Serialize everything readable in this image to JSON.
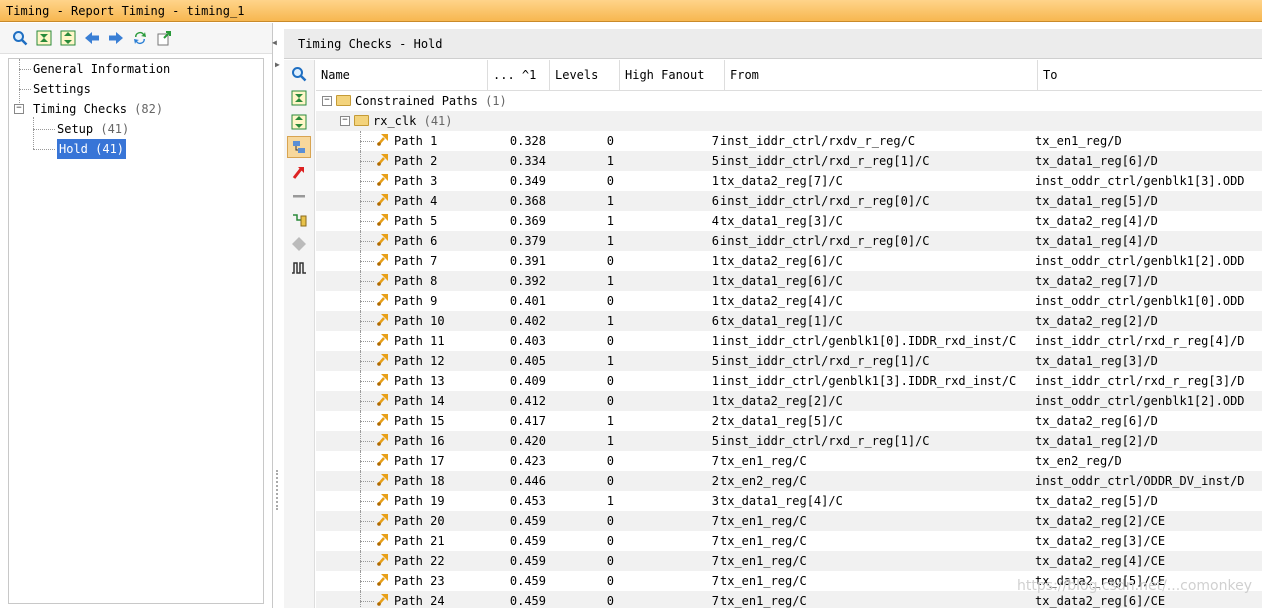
{
  "window": {
    "title": "Timing - Report Timing - timing_1"
  },
  "left_toolbar": {
    "icons": [
      "search-icon",
      "collapse-all-icon",
      "expand-all-icon",
      "back-icon",
      "forward-icon",
      "refresh-icon",
      "export-icon"
    ]
  },
  "tree": {
    "general": "General Information",
    "settings": "Settings",
    "timing_checks": {
      "label": "Timing Checks",
      "count": "(82)"
    },
    "setup": {
      "label": "Setup",
      "count": "(41)"
    },
    "hold": {
      "label": "Hold (41)"
    }
  },
  "panel": {
    "title": "Timing Checks - Hold"
  },
  "vtoolbar": {
    "icons": [
      "search-icon",
      "collapse-all-icon",
      "expand-all-icon",
      "group-icon",
      "route-icon",
      "minus-icon",
      "schematic-icon",
      "diamond-icon",
      "waveform-icon"
    ]
  },
  "table": {
    "headers": {
      "name": "Name",
      "slack": "... ^1",
      "levels": "Levels",
      "fanout": "High Fanout",
      "from": "From",
      "to": "To"
    },
    "group": {
      "label": "Constrained Paths",
      "count": "(1)"
    },
    "clock": {
      "label": "rx_clk",
      "count": "(41)"
    },
    "rows": [
      {
        "name": "Path 1",
        "slack": "0.328",
        "levels": "0",
        "fanout": "7",
        "from": "inst_iddr_ctrl/rxdv_r_reg/C",
        "to": "tx_en1_reg/D"
      },
      {
        "name": "Path 2",
        "slack": "0.334",
        "levels": "1",
        "fanout": "5",
        "from": "inst_iddr_ctrl/rxd_r_reg[1]/C",
        "to": "tx_data1_reg[6]/D"
      },
      {
        "name": "Path 3",
        "slack": "0.349",
        "levels": "0",
        "fanout": "1",
        "from": "tx_data2_reg[7]/C",
        "to": "inst_oddr_ctrl/genblk1[3].ODD"
      },
      {
        "name": "Path 4",
        "slack": "0.368",
        "levels": "1",
        "fanout": "6",
        "from": "inst_iddr_ctrl/rxd_r_reg[0]/C",
        "to": "tx_data1_reg[5]/D"
      },
      {
        "name": "Path 5",
        "slack": "0.369",
        "levels": "1",
        "fanout": "4",
        "from": "tx_data1_reg[3]/C",
        "to": "tx_data2_reg[4]/D"
      },
      {
        "name": "Path 6",
        "slack": "0.379",
        "levels": "1",
        "fanout": "6",
        "from": "inst_iddr_ctrl/rxd_r_reg[0]/C",
        "to": "tx_data1_reg[4]/D"
      },
      {
        "name": "Path 7",
        "slack": "0.391",
        "levels": "0",
        "fanout": "1",
        "from": "tx_data2_reg[6]/C",
        "to": "inst_oddr_ctrl/genblk1[2].ODD"
      },
      {
        "name": "Path 8",
        "slack": "0.392",
        "levels": "1",
        "fanout": "1",
        "from": "tx_data1_reg[6]/C",
        "to": "tx_data2_reg[7]/D"
      },
      {
        "name": "Path 9",
        "slack": "0.401",
        "levels": "0",
        "fanout": "1",
        "from": "tx_data2_reg[4]/C",
        "to": "inst_oddr_ctrl/genblk1[0].ODD"
      },
      {
        "name": "Path 10",
        "slack": "0.402",
        "levels": "1",
        "fanout": "6",
        "from": "tx_data1_reg[1]/C",
        "to": "tx_data2_reg[2]/D"
      },
      {
        "name": "Path 11",
        "slack": "0.403",
        "levels": "0",
        "fanout": "1",
        "from": "inst_iddr_ctrl/genblk1[0].IDDR_rxd_inst/C",
        "to": "inst_iddr_ctrl/rxd_r_reg[4]/D"
      },
      {
        "name": "Path 12",
        "slack": "0.405",
        "levels": "1",
        "fanout": "5",
        "from": "inst_iddr_ctrl/rxd_r_reg[1]/C",
        "to": "tx_data1_reg[3]/D"
      },
      {
        "name": "Path 13",
        "slack": "0.409",
        "levels": "0",
        "fanout": "1",
        "from": "inst_iddr_ctrl/genblk1[3].IDDR_rxd_inst/C",
        "to": "inst_iddr_ctrl/rxd_r_reg[3]/D"
      },
      {
        "name": "Path 14",
        "slack": "0.412",
        "levels": "0",
        "fanout": "1",
        "from": "tx_data2_reg[2]/C",
        "to": "inst_oddr_ctrl/genblk1[2].ODD"
      },
      {
        "name": "Path 15",
        "slack": "0.417",
        "levels": "1",
        "fanout": "2",
        "from": "tx_data1_reg[5]/C",
        "to": "tx_data2_reg[6]/D"
      },
      {
        "name": "Path 16",
        "slack": "0.420",
        "levels": "1",
        "fanout": "5",
        "from": "inst_iddr_ctrl/rxd_r_reg[1]/C",
        "to": "tx_data1_reg[2]/D"
      },
      {
        "name": "Path 17",
        "slack": "0.423",
        "levels": "0",
        "fanout": "7",
        "from": "tx_en1_reg/C",
        "to": "tx_en2_reg/D"
      },
      {
        "name": "Path 18",
        "slack": "0.446",
        "levels": "0",
        "fanout": "2",
        "from": "tx_en2_reg/C",
        "to": "inst_oddr_ctrl/ODDR_DV_inst/D"
      },
      {
        "name": "Path 19",
        "slack": "0.453",
        "levels": "1",
        "fanout": "3",
        "from": "tx_data1_reg[4]/C",
        "to": "tx_data2_reg[5]/D"
      },
      {
        "name": "Path 20",
        "slack": "0.459",
        "levels": "0",
        "fanout": "7",
        "from": "tx_en1_reg/C",
        "to": "tx_data2_reg[2]/CE"
      },
      {
        "name": "Path 21",
        "slack": "0.459",
        "levels": "0",
        "fanout": "7",
        "from": "tx_en1_reg/C",
        "to": "tx_data2_reg[3]/CE"
      },
      {
        "name": "Path 22",
        "slack": "0.459",
        "levels": "0",
        "fanout": "7",
        "from": "tx_en1_reg/C",
        "to": "tx_data2_reg[4]/CE"
      },
      {
        "name": "Path 23",
        "slack": "0.459",
        "levels": "0",
        "fanout": "7",
        "from": "tx_en1_reg/C",
        "to": "tx_data2_reg[5]/CE"
      },
      {
        "name": "Path 24",
        "slack": "0.459",
        "levels": "0",
        "fanout": "7",
        "from": "tx_en1_reg/C",
        "to": "tx_data2_reg[6]/CE"
      }
    ]
  },
  "watermark": "https://blog.csdn.net/...comonkey",
  "colors": {
    "titlebar": "#f7b750",
    "selection": "#3875d7",
    "path_icon": "#e8a018",
    "row_alt": "#f1f1f1"
  }
}
